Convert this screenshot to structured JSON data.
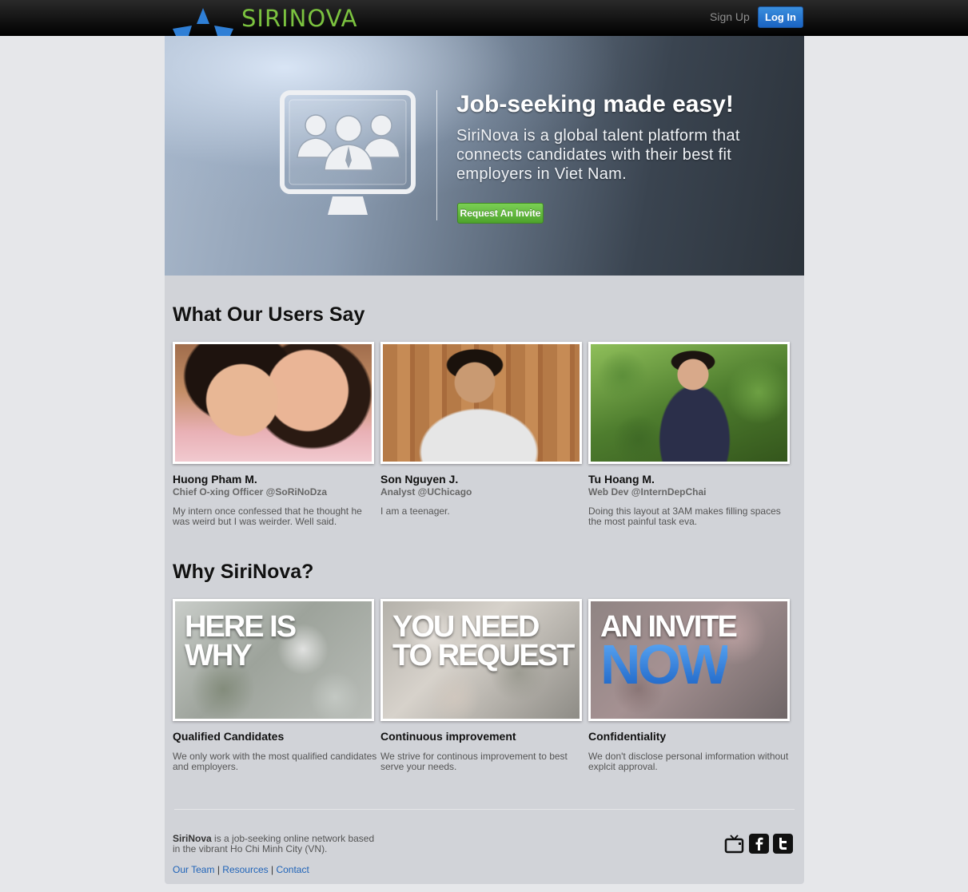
{
  "brand": {
    "name": "SIRINOVA"
  },
  "nav": {
    "signup": "Sign Up",
    "login": "Log In"
  },
  "hero": {
    "title": "Job-seeking made easy!",
    "text": "SiriNova is a global talent platform that connects candidates with their best fit employers in Viet Nam.",
    "cta": "Request An Invite"
  },
  "testimonials": {
    "heading": "What Our Users Say",
    "items": [
      {
        "name": "Huong Pham M.",
        "role": "Chief O-xing Officer @SoRiNoDza",
        "quote": "My intern once confessed that he thought he was weird but I was weirder. Well said."
      },
      {
        "name": "Son Nguyen J.",
        "role": "Analyst @UChicago",
        "quote": "I am a teenager."
      },
      {
        "name": "Tu Hoang M.",
        "role": "Web Dev @InternDepChai",
        "quote": "Doing this layout at 3AM makes filling spaces the most painful task eva."
      }
    ]
  },
  "why": {
    "heading": "Why SiriNova?",
    "items": [
      {
        "image_text_1": "HERE IS",
        "image_text_2": "WHY",
        "title": "Qualified Candidates",
        "text": "We only work with the most qualified candidates and employers."
      },
      {
        "image_text_1": "YOU NEED",
        "image_text_2": "TO REQUEST",
        "title": "Continuous improvement",
        "text": "We strive for continous improvement to best serve your needs."
      },
      {
        "image_text_1": "AN INVITE",
        "image_text_2": "NOW",
        "title": "Confidentiality",
        "text": "We don't disclose personal imformation without explcit approval."
      }
    ]
  },
  "footer": {
    "brand": "SiriNova",
    "about": " is a job-seeking online network based in the vibrant Ho Chi Minh City (VN).",
    "links": [
      "Our Team",
      "Resources",
      "Contact"
    ],
    "separator": "|",
    "social_icons": [
      "tv-icon",
      "facebook-icon",
      "twitter-icon"
    ]
  },
  "colors": {
    "brand_green": "#7bc23f",
    "login_blue": "#1a63c2",
    "cta_green": "#4ea32c",
    "link_blue": "#1f63b8"
  }
}
